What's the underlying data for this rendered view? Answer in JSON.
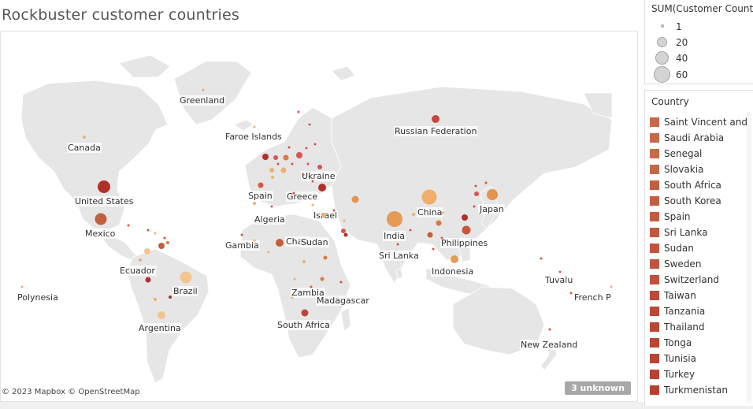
{
  "title": "Rockbuster customer countries",
  "attribution": "© 2023 Mapbox © OpenStreetMap",
  "unknown_badge": "3 unknown",
  "size_legend": {
    "title": "SUM(Customer Count)",
    "items": [
      {
        "label": "1",
        "value": 1
      },
      {
        "label": "20",
        "value": 20
      },
      {
        "label": "40",
        "value": 40
      },
      {
        "label": "60",
        "value": 60
      }
    ]
  },
  "color_legend": {
    "title": "Country",
    "items": [
      {
        "label": "Saint Vincent and ..",
        "color": "#c8674a"
      },
      {
        "label": "Saudi Arabia",
        "color": "#c8674a"
      },
      {
        "label": "Senegal",
        "color": "#c86a48"
      },
      {
        "label": "Slovakia",
        "color": "#c4684a"
      },
      {
        "label": "South Africa",
        "color": "#c25f42"
      },
      {
        "label": "South Korea",
        "color": "#c25e41"
      },
      {
        "label": "Spain",
        "color": "#c25c40"
      },
      {
        "label": "Sri Lanka",
        "color": "#c0583e"
      },
      {
        "label": "Sudan",
        "color": "#c0563c"
      },
      {
        "label": "Sweden",
        "color": "#bf553b"
      },
      {
        "label": "Switzerland",
        "color": "#be523a"
      },
      {
        "label": "Taiwan",
        "color": "#bb4a37"
      },
      {
        "label": "Tanzania",
        "color": "#bb4936"
      },
      {
        "label": "Thailand",
        "color": "#ba4735"
      },
      {
        "label": "Tonga",
        "color": "#ba4635"
      },
      {
        "label": "Tunisia",
        "color": "#b94434"
      },
      {
        "label": "Turkey",
        "color": "#b84233"
      },
      {
        "label": "Turkmenistan",
        "color": "#b74032"
      }
    ]
  },
  "map": {
    "labels": [
      "Greenland",
      "Canada",
      "United States",
      "Mexico",
      "Ecuador",
      "Brazil",
      "Argentina",
      "Polynesia",
      "Faroe Islands",
      "Ukraine",
      "Spain",
      "Greece",
      "Algeria",
      "Israel",
      "Gambia",
      "Chad",
      "Sudan",
      "Zambia",
      "Madagascar",
      "South Africa",
      "Russian Federation",
      "China",
      "Japan",
      "India",
      "Sri Lanka",
      "Philippines",
      "Indonesia",
      "Tuvalu",
      "French P",
      "New Zealand"
    ],
    "colors": {
      "land": "#e6e6e6",
      "border": "#ffffff",
      "small": "#d9534f",
      "dark_red": "#b2302a",
      "orange": "#d97a3f",
      "light_orange": "#eeb06a",
      "peach": "#f2c590"
    }
  }
}
